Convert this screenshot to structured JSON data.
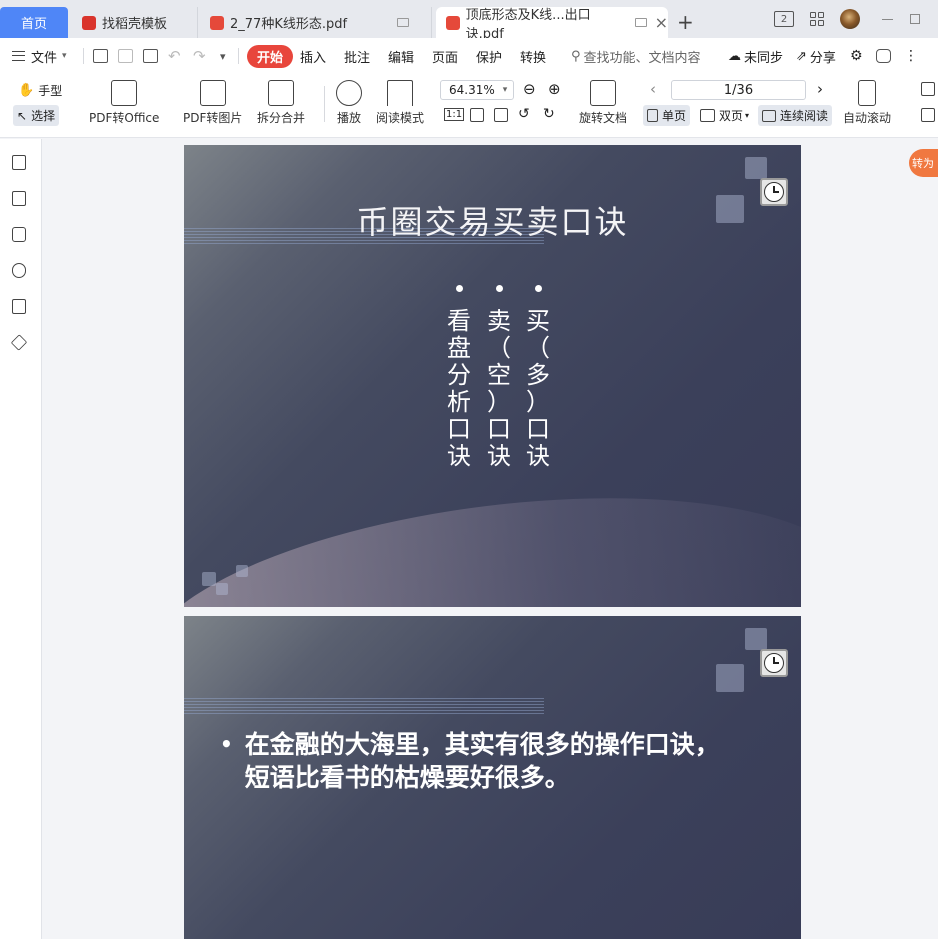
{
  "tabs": {
    "home": "首页",
    "items": [
      {
        "label": "找稻壳模板"
      },
      {
        "label": "2_77种K线形态.pdf"
      },
      {
        "label": "顶底形态及K线...出口诀.pdf"
      }
    ],
    "add": "+",
    "close": "×",
    "layout_badge": "2"
  },
  "menu": {
    "file": "文件",
    "items": [
      "开始",
      "插入",
      "批注",
      "编辑",
      "页面",
      "保护",
      "转换"
    ],
    "search": "查找功能、文档内容",
    "sync": "未同步",
    "share": "分享"
  },
  "ribbon": {
    "hand": "手型",
    "select": "选择",
    "pdf_to_office": "PDF转Office",
    "pdf_to_image": "PDF转图片",
    "split_merge": "拆分合并",
    "play": "播放",
    "read_mode": "阅读模式",
    "zoom": "64.31%",
    "rotate": "旋转文档",
    "page": "1/36",
    "single": "单页",
    "double": "双页",
    "continuous": "连续阅读",
    "auto_scroll": "自动滚动",
    "actual_size": "1:1"
  },
  "slide1": {
    "title": "币圈交易买卖口诀",
    "columns": [
      {
        "text": [
          "看",
          "盘",
          "分",
          "析",
          "口",
          "诀"
        ]
      },
      {
        "text": [
          "卖",
          "（",
          "空",
          "）",
          "口",
          "诀"
        ]
      },
      {
        "text": [
          "买",
          "（",
          "多",
          "）",
          "口",
          "诀"
        ]
      }
    ]
  },
  "slide2": {
    "bullet": "•",
    "text": "在金融的大海里，其实有很多的操作口诀，短语比看书的枯燥要好很多。"
  },
  "convert_badge": "转为"
}
